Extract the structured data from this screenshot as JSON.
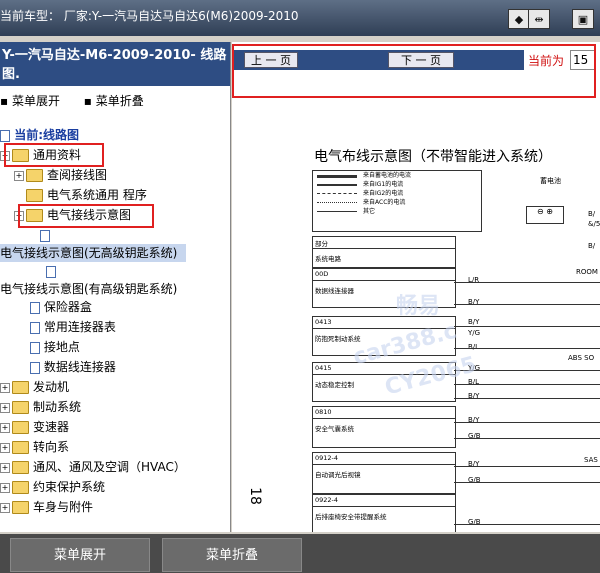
{
  "header": {
    "title": "当前车型：  厂家:Y-一汽马自达马自达6(M6)2009-2010"
  },
  "left": {
    "title": "Y-一汽马自达-M6-2009-2010- 线路图.",
    "expand": "菜单展开",
    "collapse": "菜单折叠",
    "tree": [
      {
        "label": "当前:线路图",
        "kind": "root"
      },
      {
        "label": "通用资料",
        "kind": "folder"
      },
      {
        "label": "查阅接线图",
        "kind": "folder"
      },
      {
        "label": "电气系统通用 程序",
        "kind": "folder"
      },
      {
        "label": "电气接线示意图",
        "kind": "folder"
      },
      {
        "label": "电气接线示意图(无高级钥匙系统)",
        "kind": "page"
      },
      {
        "label": "电气接线示意图(有高级钥匙系统)",
        "kind": "page"
      },
      {
        "label": "保险器盒",
        "kind": "page"
      },
      {
        "label": "常用连接器表",
        "kind": "page"
      },
      {
        "label": "接地点",
        "kind": "page"
      },
      {
        "label": "数据线连接器",
        "kind": "page"
      },
      {
        "label": "发动机",
        "kind": "folder"
      },
      {
        "label": "制动系统",
        "kind": "folder"
      },
      {
        "label": "变速器",
        "kind": "folder"
      },
      {
        "label": "转向系",
        "kind": "folder"
      },
      {
        "label": "通风、通风及空调（HVAC）",
        "kind": "folder"
      },
      {
        "label": "约束保护系统",
        "kind": "folder"
      },
      {
        "label": "车身与附件",
        "kind": "folder"
      }
    ]
  },
  "nav": {
    "prev": "上 一 页",
    "next": "下 一 页",
    "current_label": "当前为",
    "current_page": "15"
  },
  "diagram": {
    "title": "电气布线示意图（不带智能进入系统）",
    "legend": [
      "来自蓄电池的电流",
      "来自IG1的电流",
      "来自IG2的电流",
      "来自ACC的电流",
      "其它"
    ],
    "battery": "蓄电池",
    "section": {
      "code": "部分",
      "name": "系统电路"
    },
    "systems": [
      {
        "code": "00D",
        "name": "数据线连接器"
      },
      {
        "code": "0413",
        "name": "防抱死制动系统"
      },
      {
        "code": "0415",
        "name": "动态稳定控制"
      },
      {
        "code": "0810",
        "name": "安全气囊系统"
      },
      {
        "code": "0912-4",
        "name": "自动调光后视镜"
      },
      {
        "code": "0922-4",
        "name": "后排座椅安全带提醒系统"
      }
    ],
    "wires": [
      "L/R",
      "B/Y",
      "B/Y",
      "Y/G",
      "B/L",
      "Y/G",
      "B/L",
      "B/Y",
      "B/Y",
      "G/B",
      "B/Y",
      "G/B",
      "G/B"
    ],
    "right_labels": [
      "ROOM",
      "ABS SO",
      "SAS"
    ],
    "batt_labels": [
      "B/",
      "&/5",
      "B/"
    ],
    "page_number": "18",
    "watermark": [
      "畅易",
      "car388.c",
      "CY2065"
    ]
  },
  "bottom": {
    "expand": "菜单展开",
    "collapse": "菜单折叠"
  }
}
